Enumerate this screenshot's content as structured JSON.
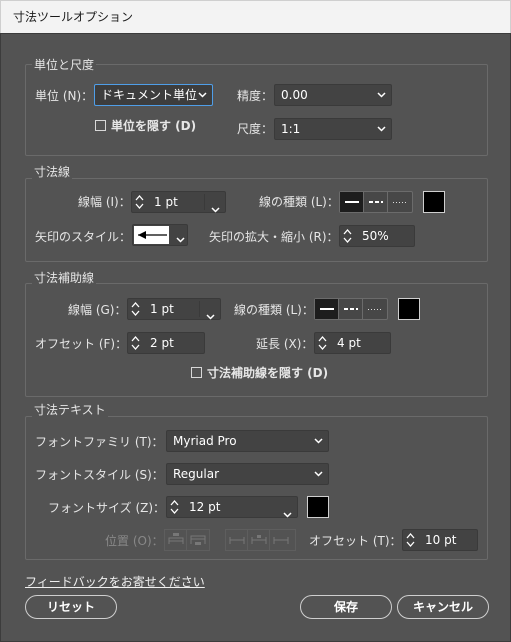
{
  "window": {
    "title": "寸法ツールオプション"
  },
  "units": {
    "section": "単位と尺度",
    "unit_label": "単位 (N)：",
    "unit_value": "ドキュメント単位",
    "precision_label": "精度：",
    "precision_value": "0.00",
    "hide_units_label": "単位を隠す (D)",
    "scale_label": "尺度：",
    "scale_value": "1:1"
  },
  "dimension_line": {
    "section": "寸法線",
    "width_label": "線幅 (I)：",
    "width_value": "1 pt",
    "type_label": "線の種類 (L)：",
    "arrow_style_label": "矢印のスタイル：",
    "arrow_scale_label": "矢印の拡大・縮小 (R)：",
    "arrow_scale_value": "50%",
    "color": "#000000"
  },
  "extension_line": {
    "section": "寸法補助線",
    "width_label": "線幅 (G)：",
    "width_value": "1 pt",
    "type_label": "線の種類 (L)：",
    "offset_label": "オフセット (F)：",
    "offset_value": "2 pt",
    "extension_label": "延長 (X)：",
    "extension_value": "4 pt",
    "hide_label": "寸法補助線を隠す (D)",
    "color": "#000000"
  },
  "dimension_text": {
    "section": "寸法テキスト",
    "font_family_label": "フォントファミリ (T)：",
    "font_family_value": "Myriad Pro",
    "font_style_label": "フォントスタイル (S)：",
    "font_style_value": "Regular",
    "font_size_label": "フォントサイズ (Z)：",
    "font_size_value": "12 pt",
    "position_label": "位置 (O)：",
    "offset_label": "オフセット (T)：",
    "offset_value": "10 pt",
    "color": "#000000"
  },
  "footer": {
    "feedback_link": "フィードバックをお寄せください",
    "reset_label": "リセット",
    "save_label": "保存",
    "cancel_label": "キャンセル"
  }
}
